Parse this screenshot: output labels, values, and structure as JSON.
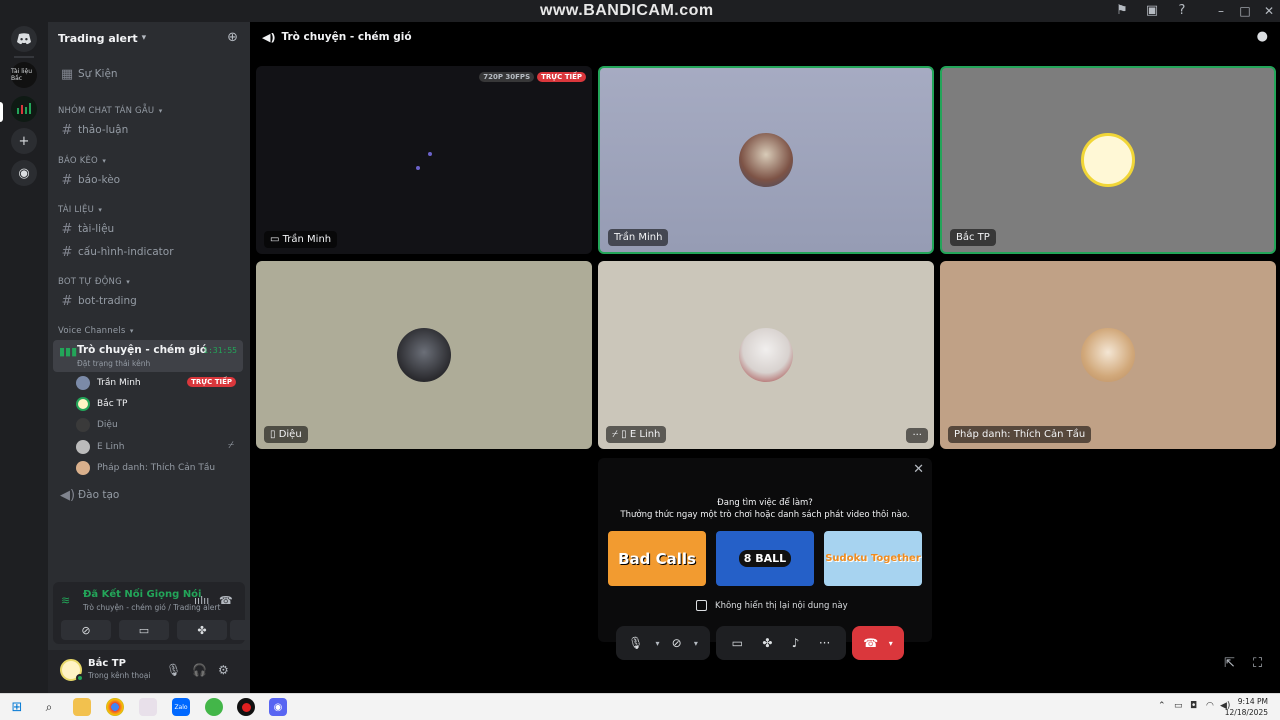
{
  "watermark": "www.BANDICAM.com",
  "server_rail": {
    "server1_label": "Tài liệu Bắc"
  },
  "sidebar": {
    "server_name": "Trading alert",
    "events_label": "Sự Kiện",
    "categories": [
      {
        "label": "NHÓM CHAT TÁN GẪU",
        "channels": [
          "thảo-luận"
        ]
      },
      {
        "label": "BÁO KÈO",
        "channels": [
          "báo-kèo"
        ]
      },
      {
        "label": "TÀI LIỆU",
        "channels": [
          "tài-liệu",
          "cấu-hình-indicator"
        ]
      },
      {
        "label": "BOT TỰ ĐỘNG",
        "channels": [
          "bot-trading"
        ]
      }
    ],
    "voice_category": "Voice Channels",
    "active_voice": {
      "name": "Trò chuyện - chém gió",
      "status": "Đặt trạng thái kênh",
      "elapsed": "1:31:55"
    },
    "members": [
      {
        "name": "Trần Minh",
        "badge": "TRỰC TIẾP"
      },
      {
        "name": "Bắc TP"
      },
      {
        "name": "Diệu"
      },
      {
        "name": "E Linh"
      },
      {
        "name": "Pháp danh: Thích Cản Tầu"
      }
    ],
    "other_voice": "Đào tạo"
  },
  "voice_panel": {
    "title": "Đã Kết Nối Giọng Nói",
    "subtitle": "Trò chuyện - chém gió / Trading alert"
  },
  "user_panel": {
    "name": "Bắc TP",
    "status": "Trong kênh thoại"
  },
  "call": {
    "channel_title": "Trò chuyện - chém gió",
    "tiles": [
      {
        "label": "Trần Minh",
        "quality": "720P 30FPS",
        "live": "TRỰC TIẾP"
      },
      {
        "label": "Trần Minh"
      },
      {
        "label": "Bắc TP"
      },
      {
        "label": "Diệu"
      },
      {
        "label": "E Linh"
      },
      {
        "label": "Pháp danh: Thích Cản Tầu"
      }
    ]
  },
  "activity": {
    "title": "Đang tìm việc để làm?",
    "subtitle": "Thưởng thức ngay một trò chơi hoặc danh sách phát video thôi nào.",
    "games": [
      "Bad Calls",
      "8 BALL",
      "Sudoku Together"
    ],
    "checkbox_label": "Không hiển thị lại nội dung này"
  },
  "taskbar": {
    "time": "9:14 PM",
    "date": "12/18/2025"
  },
  "colors": {
    "accent_green": "#23a559",
    "live_red": "#da373c",
    "sidebar_bg": "#2b2d31",
    "rail_bg": "#1e1f22"
  }
}
